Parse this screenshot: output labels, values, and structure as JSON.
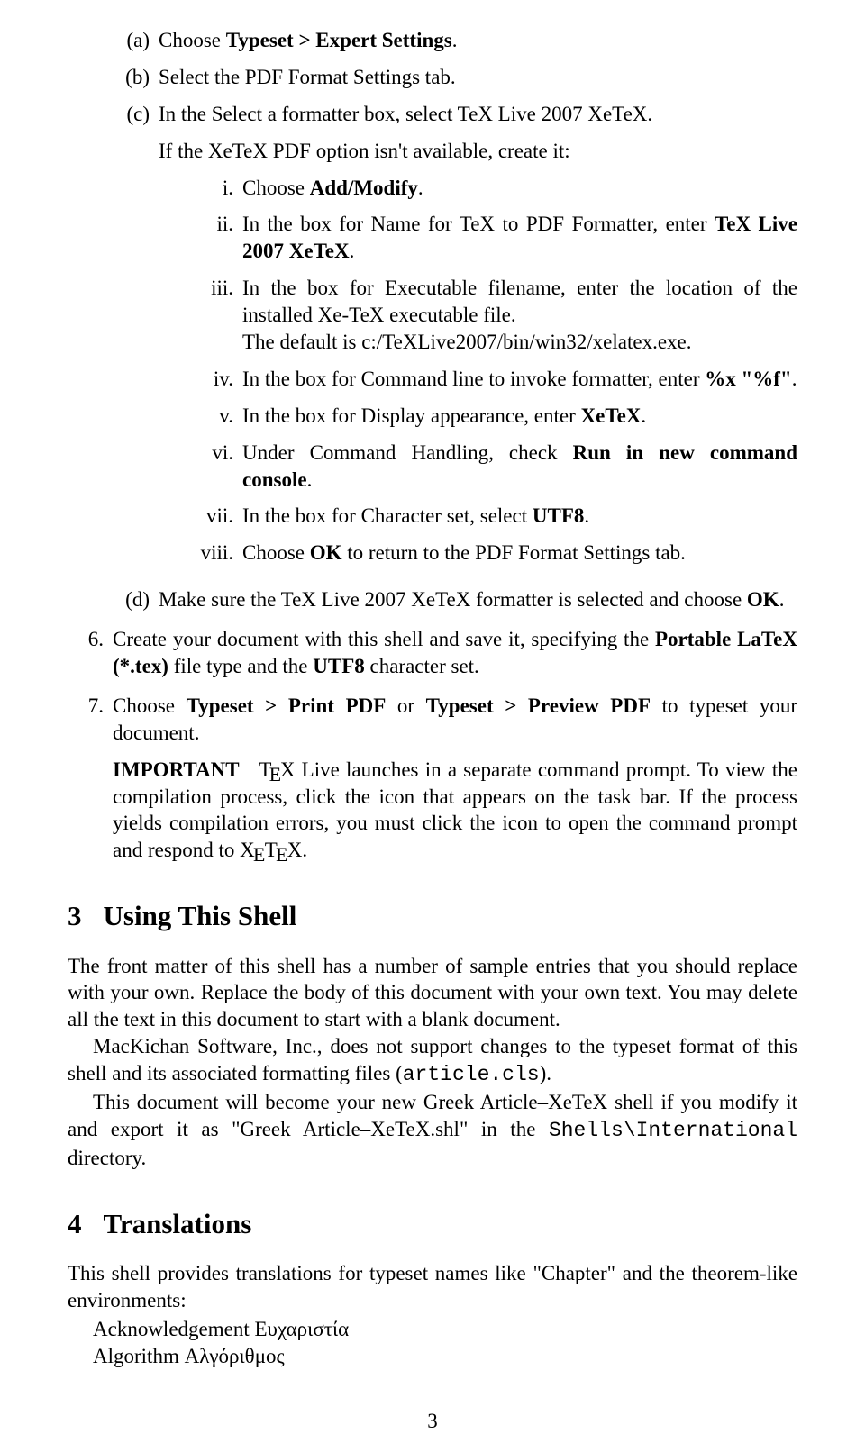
{
  "abc": {
    "a_marker": "(a)",
    "a": "Choose ",
    "a_bold": "Typeset > Expert Settings",
    "a_tail": ".",
    "b_marker": "(b)",
    "b": "Select the PDF Format Settings tab.",
    "c_marker": "(c)",
    "c": "In the Select a formatter box, select TeX Live 2007 XeTeX.",
    "c_line2": "If the XeTeX PDF option isn't available, create it:",
    "d_marker": "(d)",
    "d": "Make sure the TeX Live 2007 XeTeX formatter is selected and choose ",
    "d_bold": "OK",
    "d_tail": "."
  },
  "roman": {
    "i_m": "i.",
    "i_a": "Choose ",
    "i_b": "Add/Modify",
    "i_c": ".",
    "ii_m": "ii.",
    "ii_a": "In the box for Name for TeX to PDF Formatter, enter ",
    "ii_b": "TeX Live 2007 XeTeX",
    "ii_c": ".",
    "iii_m": "iii.",
    "iii_a": "In the box for Executable filename, enter the location of the installed Xe-TeX executable file.",
    "iii_b": "The default is c:/TeXLive2007/bin/win32/xelatex.exe.",
    "iv_m": "iv.",
    "iv_a": "In the box for Command line to invoke formatter, enter ",
    "iv_b": "%x \"%f\"",
    "iv_c": ".",
    "v_m": "v.",
    "v_a": "In the box for Display appearance, enter ",
    "v_b": "XeTeX",
    "v_c": ".",
    "vi_m": "vi.",
    "vi_a": "Under Command Handling, check ",
    "vi_b": "Run in new command console",
    "vi_c": ".",
    "vii_m": "vii.",
    "vii_a": "In the box for Character set, select ",
    "vii_b": "UTF8",
    "vii_c": ".",
    "viii_m": "viii.",
    "viii_a": "Choose ",
    "viii_b": "OK",
    "viii_c": " to return to the PDF Format Settings tab."
  },
  "num": {
    "n6_m": "6.",
    "n6_a": "Create your document with this shell and save it, specifying the ",
    "n6_b": "Portable LaTeX (*.tex)",
    "n6_c": " file type and the ",
    "n6_d": "UTF8",
    "n6_e": " character set.",
    "n7_m": "7.",
    "n7_a": "Choose ",
    "n7_b": "Typeset > Print PDF",
    "n7_c": " or ",
    "n7_d": "Typeset > Preview PDF",
    "n7_e": " to typeset your document.",
    "n7_imp": "IMPORTANT",
    "n7_p1a": "X Live launches in a separate command prompt. To view the compilation process, click the icon that appears on the task bar. If the process yields compilation errors, you must click the icon to open the command prompt and respond to X",
    "n7_p1b": "X."
  },
  "sec3_num": "3",
  "sec3_title": "Using This Shell",
  "sec3_p1": "The front matter of this shell has a number of sample entries that you should replace with your own. Replace the body of this document with your own text. You may delete all the text in this document to start with a blank document.",
  "sec3_p2a": "MacKichan Software, Inc., does not support changes to the typeset format of this shell and its associated formatting files (",
  "sec3_p2b": "article.cls",
  "sec3_p2c": ").",
  "sec3_p3a": "This document will become your new Greek Article–XeTeX shell if you modify it and export it as \"Greek Article–XeTeX.shl\" in the ",
  "sec3_p3b": "Shells\\International",
  "sec3_p3c": " directory.",
  "sec4_num": "4",
  "sec4_title": "Translations",
  "sec4_p1": "This shell provides translations for typeset names like \"Chapter\" and the theorem-like environments:",
  "trans": {
    "ack_en": "Acknowledgement ",
    "ack_gr": "Ευχαριστία",
    "alg_en": "Algorithm ",
    "alg_gr": "Αλγόριθμος"
  },
  "pagenum": "3"
}
